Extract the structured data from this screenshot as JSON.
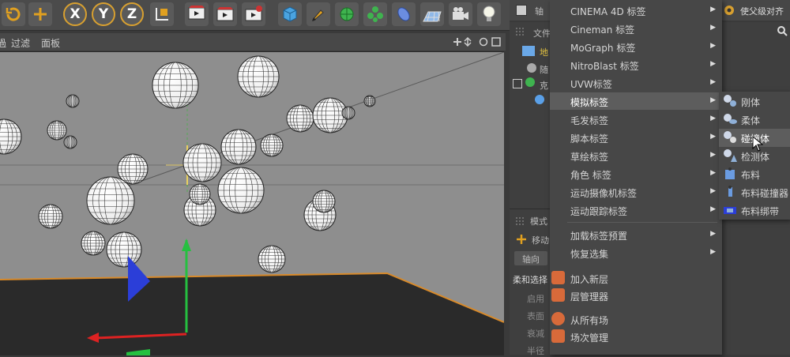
{
  "viewport_menu": {
    "item1": "過",
    "item2": "过滤",
    "item3": "面板"
  },
  "right_panel": {
    "top_tab": "轴",
    "top_right_text": "使父级对齐",
    "objects_tab": "文件",
    "tree": [
      "地",
      "随",
      "克"
    ],
    "mode_tab": "模式",
    "move_label": "移动",
    "axis_tab": "轴向",
    "soft_select": "柔和选择",
    "attrs": [
      "启用",
      "表面",
      "衰减",
      "半径"
    ]
  },
  "context_menu": {
    "items": [
      {
        "label": "CINEMA 4D 标签",
        "arrow": "▶"
      },
      {
        "label": "Cineman 标签",
        "arrow": "▶"
      },
      {
        "label": "MoGraph 标签",
        "arrow": "▶"
      },
      {
        "label": "NitroBlast 标签",
        "arrow": "▶"
      },
      {
        "label": "UVW标签",
        "arrow": "▶"
      },
      {
        "label": "模拟标签",
        "arrow": "▶"
      },
      {
        "label": "毛发标签",
        "arrow": "▶"
      },
      {
        "label": "脚本标签",
        "arrow": "▶"
      },
      {
        "label": "草绘标签",
        "arrow": "▶"
      },
      {
        "label": "角色 标签",
        "arrow": "▶"
      },
      {
        "label": "运动摄像机标签",
        "arrow": "▶"
      },
      {
        "label": "运动跟踪标签",
        "arrow": "▶"
      },
      {
        "label": "加载标签预置",
        "arrow": "▶"
      },
      {
        "label": "恢复选集",
        "arrow": "▶"
      }
    ]
  },
  "submenu": {
    "items": [
      {
        "label": "刚体",
        "icon": "rigid-body-icon"
      },
      {
        "label": "柔体",
        "icon": "soft-body-icon"
      },
      {
        "label": "碰撞体",
        "icon": "collider-body-icon"
      },
      {
        "label": "检测体",
        "icon": "ghost-body-icon"
      },
      {
        "label": "布料",
        "icon": "cloth-icon"
      },
      {
        "label": "布料碰撞器",
        "icon": "cloth-collider-icon"
      },
      {
        "label": "布料绑带",
        "icon": "cloth-belt-icon"
      }
    ]
  },
  "layer_menu": {
    "items": [
      {
        "label": "加入新层",
        "icon": "add-layer-icon"
      },
      {
        "label": "层管理器",
        "icon": "layer-manager-icon"
      },
      {
        "label": "从所有场",
        "icon": "remove-from-layer-icon"
      },
      {
        "label": "场次管理",
        "icon": "take-manager-icon"
      }
    ]
  },
  "colors": {
    "accent": "#d8a030",
    "menu_bg": "#474747",
    "menu_hover": "#5d5d5d",
    "viewport_bg": "#8e8e8e"
  }
}
